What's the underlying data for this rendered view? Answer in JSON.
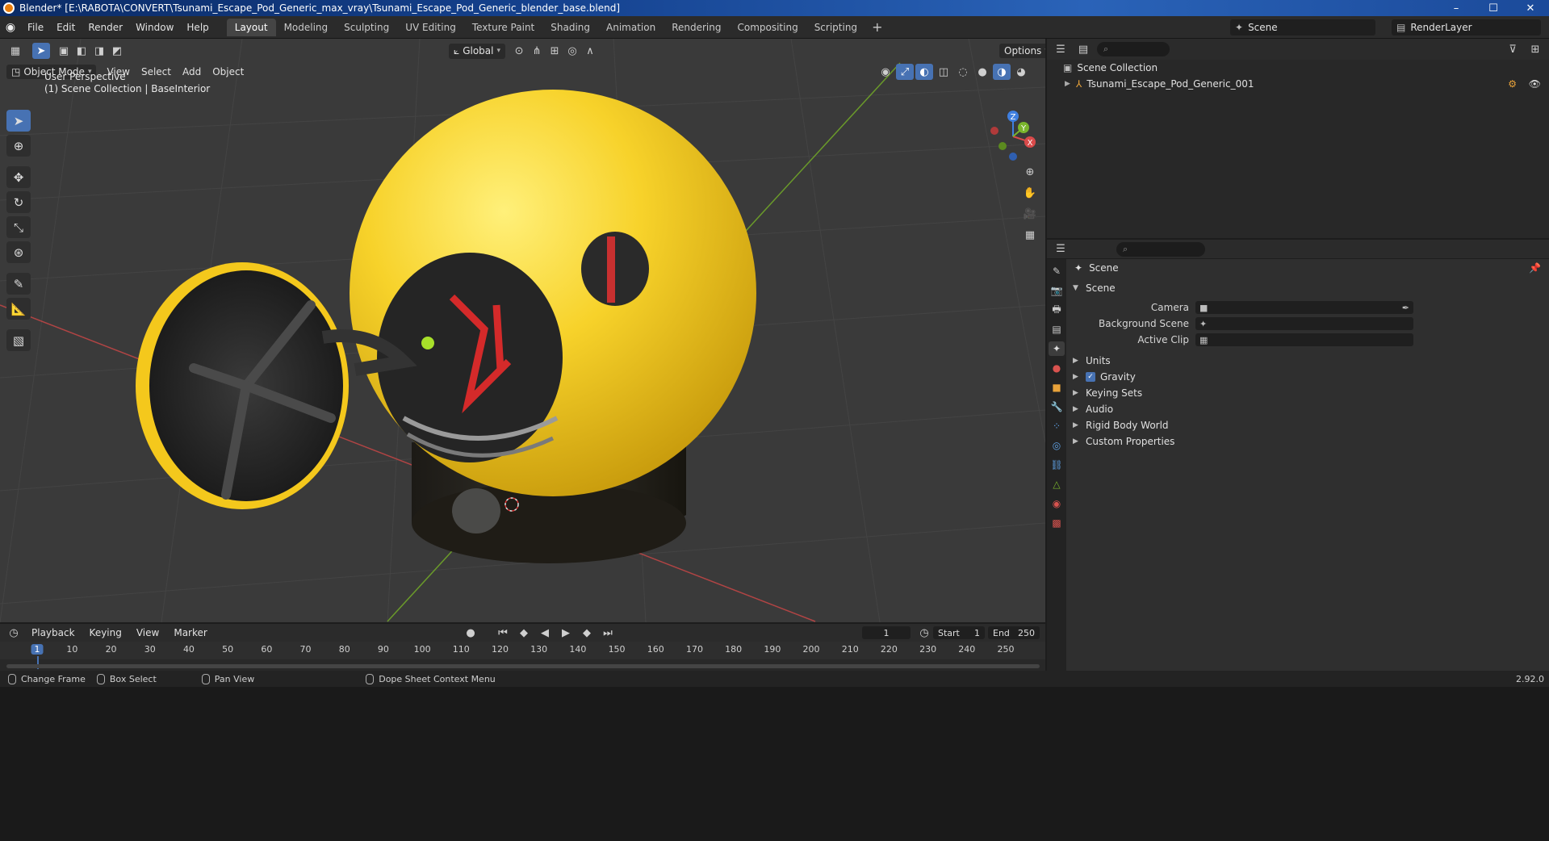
{
  "window": {
    "title": "Blender* [E:\\RABOTA\\CONVERT\\Tsunami_Escape_Pod_Generic_max_vray\\Tsunami_Escape_Pod_Generic_blender_base.blend]",
    "controls": [
      "–",
      "☐",
      "✕"
    ]
  },
  "menu": [
    "File",
    "Edit",
    "Render",
    "Window",
    "Help"
  ],
  "workspaces": [
    {
      "label": "Layout",
      "active": true
    },
    {
      "label": "Modeling"
    },
    {
      "label": "Sculpting"
    },
    {
      "label": "UV Editing"
    },
    {
      "label": "Texture Paint"
    },
    {
      "label": "Shading"
    },
    {
      "label": "Animation"
    },
    {
      "label": "Rendering"
    },
    {
      "label": "Compositing"
    },
    {
      "label": "Scripting"
    }
  ],
  "scene_selector": "Scene",
  "view_layer": "RenderLayer",
  "viewport": {
    "mode": "Object Mode",
    "menus": [
      "View",
      "Select",
      "Add",
      "Object"
    ],
    "transform_orientation": "Global",
    "options_label": "Options",
    "overlay_line1": "User Perspective",
    "overlay_line2": "(1) Scene Collection | BaseInterior",
    "gizmo_axes": {
      "x": "X",
      "y": "Y",
      "z": "Z"
    }
  },
  "outliner": {
    "root": "Scene Collection",
    "items": [
      {
        "label": "Tsunami_Escape_Pod_Generic_001"
      }
    ]
  },
  "properties": {
    "context": "Scene",
    "panel": "Scene",
    "fields": [
      {
        "label": "Camera",
        "value": ""
      },
      {
        "label": "Background Scene",
        "value": ""
      },
      {
        "label": "Active Clip",
        "value": ""
      }
    ],
    "subpanels": [
      "Units",
      "Gravity",
      "Keying Sets",
      "Audio",
      "Rigid Body World",
      "Custom Properties"
    ]
  },
  "timeline": {
    "menus": [
      "Playback",
      "Keying",
      "View",
      "Marker"
    ],
    "current_frame": "1",
    "start_label": "Start",
    "start": "1",
    "end_label": "End",
    "end": "250",
    "ticks": [
      "1",
      "10",
      "20",
      "30",
      "40",
      "50",
      "60",
      "70",
      "80",
      "90",
      "100",
      "110",
      "120",
      "130",
      "140",
      "150",
      "160",
      "170",
      "180",
      "190",
      "200",
      "210",
      "220",
      "230",
      "240",
      "250"
    ]
  },
  "statusbar": {
    "change_frame": "Change Frame",
    "box_select": "Box Select",
    "pan_view": "Pan View",
    "context_menu": "Dope Sheet Context Menu",
    "version": "2.92.0"
  },
  "colors": {
    "accent": "#4772b3",
    "pod_yellow": "#f4c81c",
    "seat_red": "#d42a2a",
    "x_axis": "#d94a4a",
    "y_axis": "#7ab52c",
    "z_axis": "#3f7fe0"
  }
}
